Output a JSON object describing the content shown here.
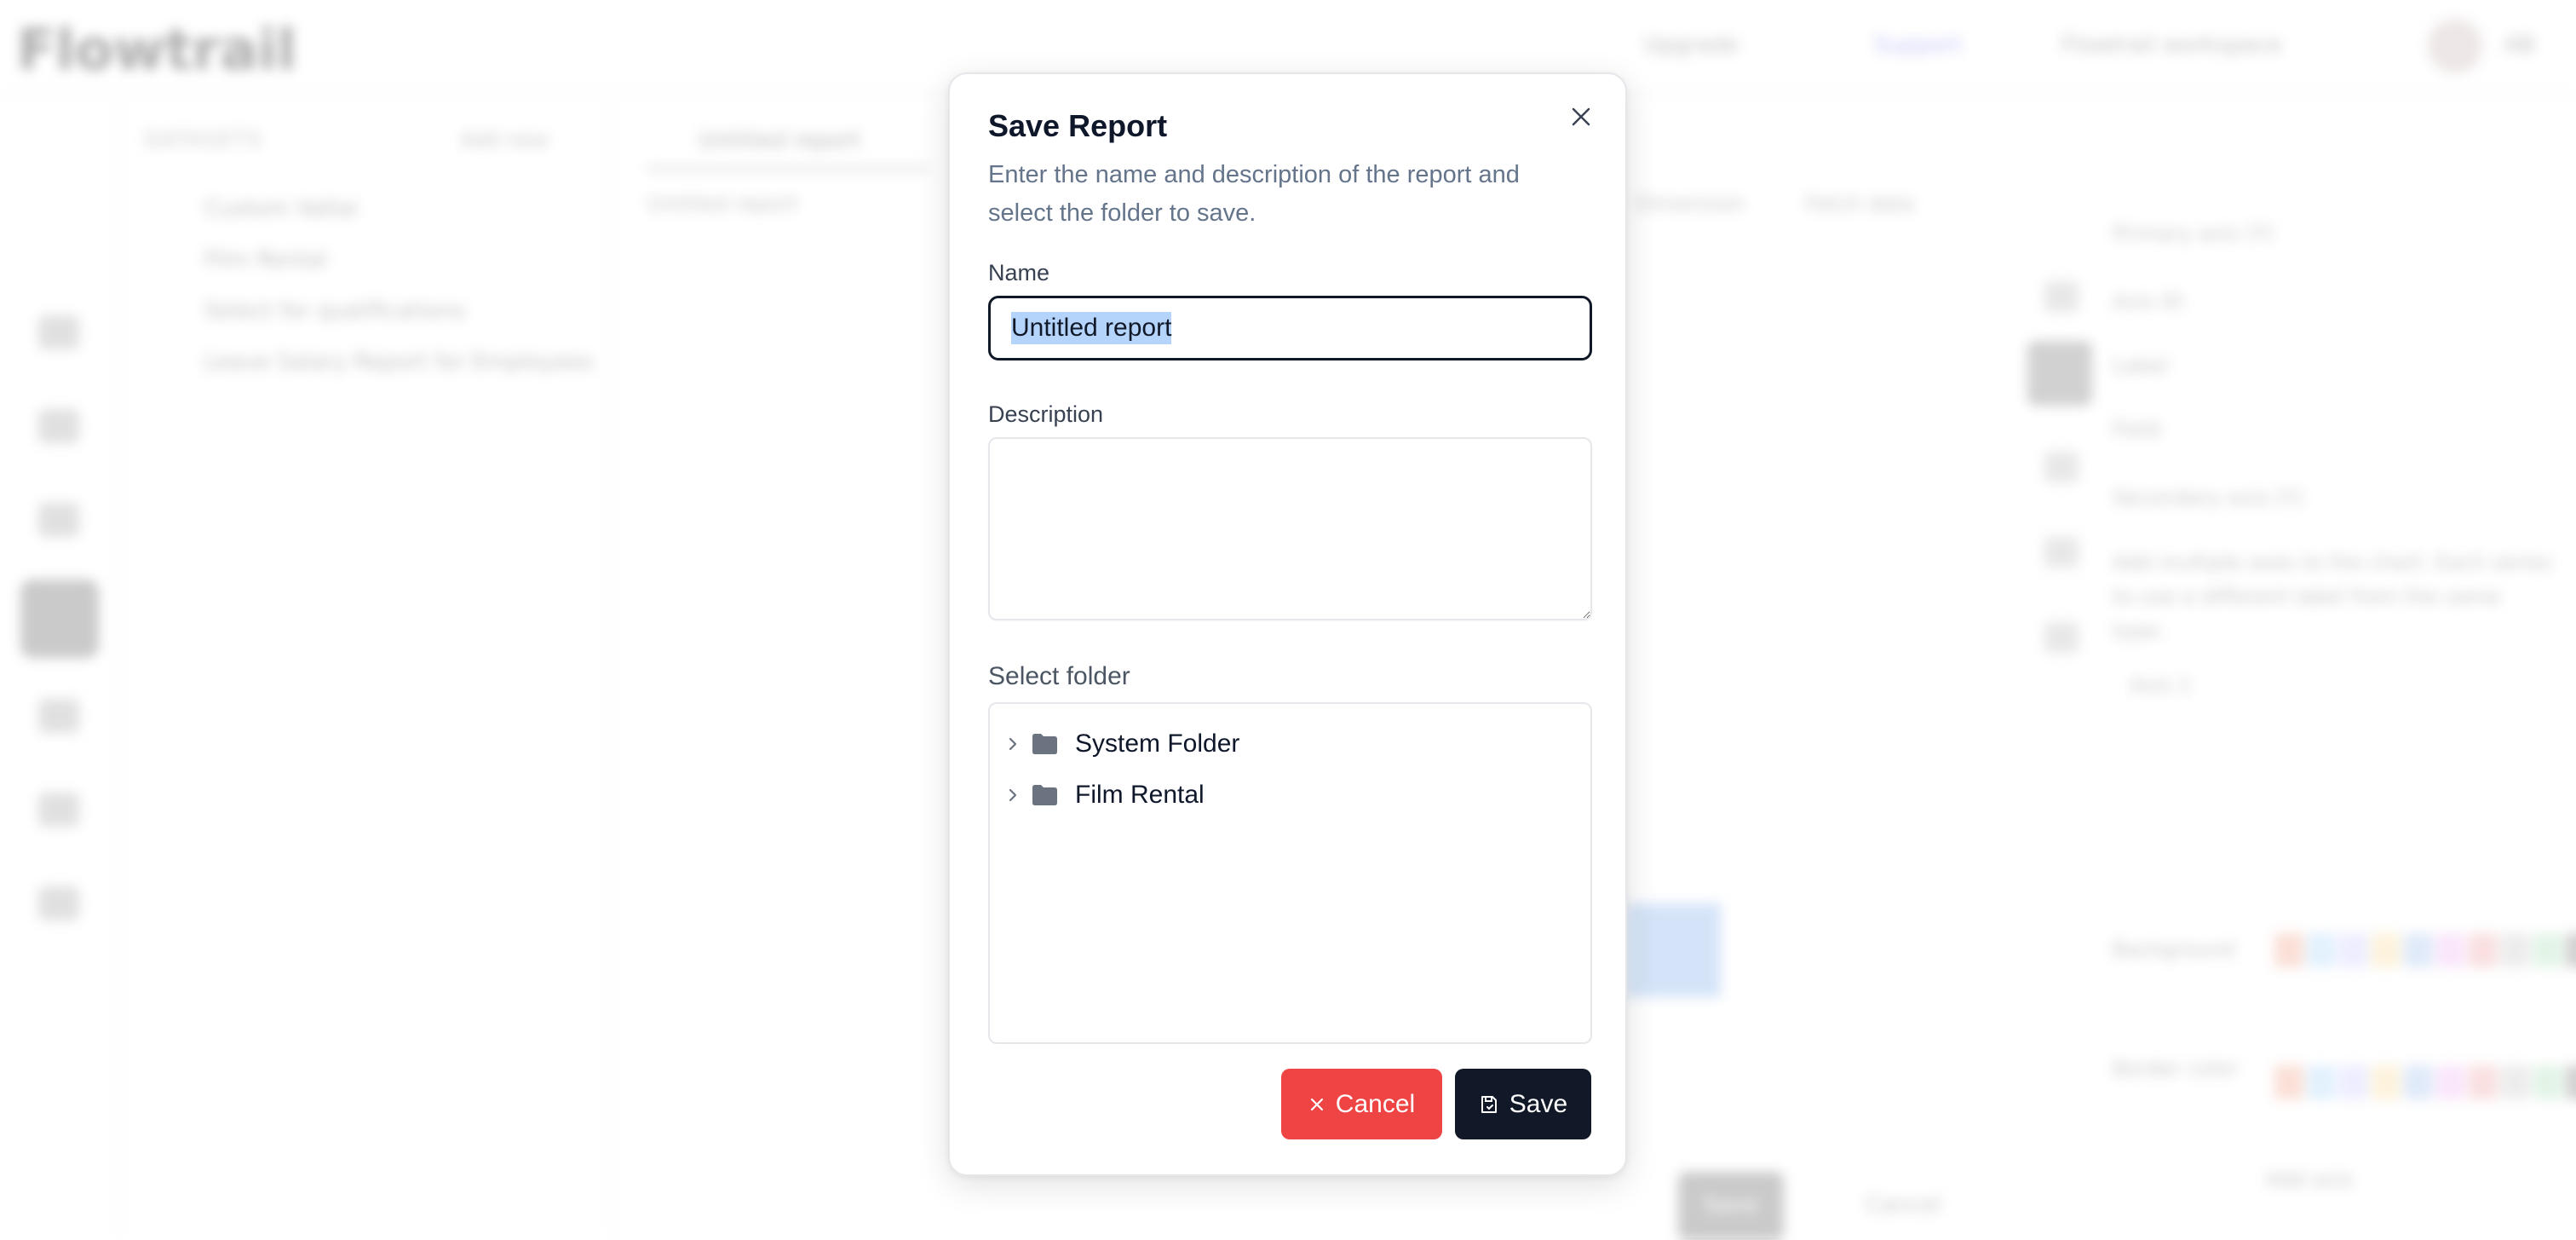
{
  "background": {
    "app_name": "Flowtrail",
    "header": {
      "upgrade": "Upgrade",
      "support": "Support",
      "workspace": "Flowtrail workspace",
      "user_initials": "AB"
    },
    "datasets_panel": {
      "title": "DATASETS",
      "add_new": "Add new",
      "items": [
        "Custom Valtai",
        "Film Rental",
        "Select for qualifications",
        "Leave Salary Report for Employees"
      ]
    },
    "report_tab": "Untitled report",
    "toolbar": {
      "breadcrumb": "Untitled report",
      "dimension": "Dimension",
      "fetch_data": "Fetch data"
    },
    "bottom_actions": {
      "save": "Save",
      "cancel": "Cancel"
    },
    "properties_panel": {
      "primary_section": "Primary axis (Y)",
      "secondary_section": "Secondary axis (Y)",
      "rows": [
        "Axis ID",
        "Label",
        "Field"
      ],
      "help_text": "Add multiple axes to the chart. Each series to use a different label from the same type.",
      "series_label": "Axis 1",
      "color_label": "Background",
      "border_label": "Border color",
      "add_axis": "Add axis"
    }
  },
  "dialog": {
    "title": "Save Report",
    "description": "Enter the name and description of the report and select the folder to save.",
    "name_label": "Name",
    "name_value": "Untitled report",
    "description_label": "Description",
    "description_value": "",
    "folder_label": "Select folder",
    "folders": [
      {
        "name": "System Folder",
        "expanded": false
      },
      {
        "name": "Film Rental",
        "expanded": false
      }
    ],
    "cancel_label": "Cancel",
    "save_label": "Save",
    "colors": {
      "cancel": "#ef4444",
      "save": "#111827",
      "selection": "#b4d4fb",
      "folder_icon": "#6b7280"
    }
  }
}
